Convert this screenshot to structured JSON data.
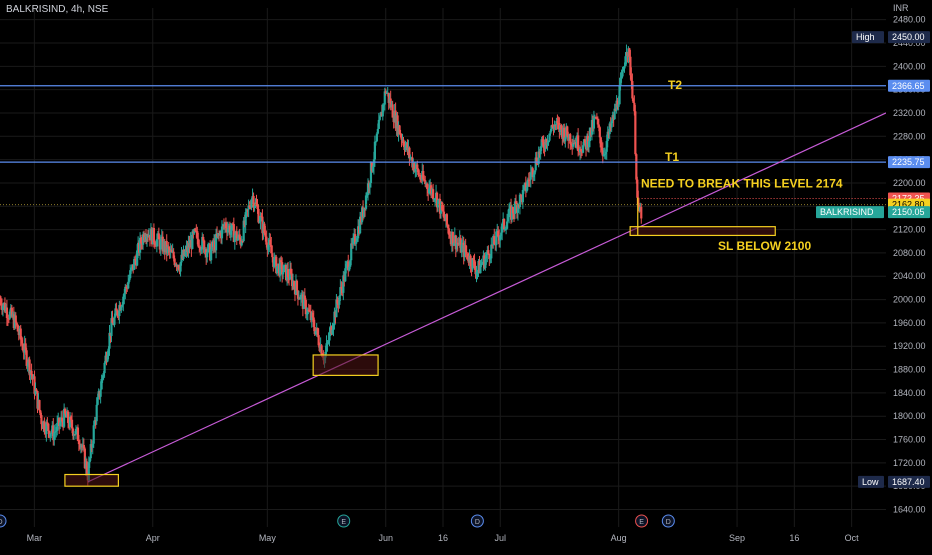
{
  "header": {
    "symbol_line": "BALKRISIND, 4h, NSE",
    "currency": "INR"
  },
  "colors": {
    "background": "#000000",
    "grid": "#1a1a1a",
    "up_candle": "#26a69a",
    "down_candle": "#ef5350",
    "level_line": "#5b8def",
    "trendline": "#c65bd6",
    "annotation": "#f5d020",
    "axis_text": "#b2b5be"
  },
  "chart_data": {
    "type": "candlestick",
    "title": "BALKRISIND, 4h, NSE",
    "ylim": [
      1610,
      2500
    ],
    "y_ticks": [
      2480,
      2440,
      2400,
      2360,
      2320,
      2280,
      2240,
      2200,
      2160,
      2120,
      2080,
      2040,
      2000,
      1960,
      1920,
      1880,
      1840,
      1800,
      1760,
      1720,
      1680,
      1640
    ],
    "x_labels": [
      {
        "label": "Mar",
        "date": "2023-03-01"
      },
      {
        "label": "Apr",
        "date": "2023-04-01"
      },
      {
        "label": "May",
        "date": "2023-05-01"
      },
      {
        "label": "Jun",
        "date": "2023-06-01"
      },
      {
        "label": "16",
        "date": "2023-06-16"
      },
      {
        "label": "Jul",
        "date": "2023-07-01"
      },
      {
        "label": "Aug",
        "date": "2023-08-01"
      },
      {
        "label": "Sep",
        "date": "2023-09-01"
      },
      {
        "label": "16",
        "date": "2023-09-16"
      },
      {
        "label": "Oct",
        "date": "2023-10-01"
      }
    ],
    "x_range": [
      "2023-02-20",
      "2023-10-10"
    ],
    "price_path": [
      [
        "2023-02-20",
        2000
      ],
      [
        "2023-02-24",
        1960
      ],
      [
        "2023-02-28",
        1880
      ],
      [
        "2023-03-03",
        1790
      ],
      [
        "2023-03-06",
        1770
      ],
      [
        "2023-03-09",
        1800
      ],
      [
        "2023-03-13",
        1760
      ],
      [
        "2023-03-15",
        1700
      ],
      [
        "2023-03-17",
        1800
      ],
      [
        "2023-03-21",
        1950
      ],
      [
        "2023-03-25",
        2020
      ],
      [
        "2023-03-30",
        2120
      ],
      [
        "2023-04-04",
        2090
      ],
      [
        "2023-04-08",
        2060
      ],
      [
        "2023-04-12",
        2110
      ],
      [
        "2023-04-16",
        2080
      ],
      [
        "2023-04-20",
        2130
      ],
      [
        "2023-04-24",
        2100
      ],
      [
        "2023-04-27",
        2180
      ],
      [
        "2023-04-29",
        2140
      ],
      [
        "2023-05-03",
        2060
      ],
      [
        "2023-05-07",
        2040
      ],
      [
        "2023-05-10",
        2000
      ],
      [
        "2023-05-13",
        1960
      ],
      [
        "2023-05-16",
        1900
      ],
      [
        "2023-05-18",
        1960
      ],
      [
        "2023-05-22",
        2060
      ],
      [
        "2023-05-26",
        2150
      ],
      [
        "2023-05-29",
        2250
      ],
      [
        "2023-06-01",
        2360
      ],
      [
        "2023-06-04",
        2300
      ],
      [
        "2023-06-07",
        2250
      ],
      [
        "2023-06-10",
        2210
      ],
      [
        "2023-06-14",
        2180
      ],
      [
        "2023-06-18",
        2110
      ],
      [
        "2023-06-22",
        2080
      ],
      [
        "2023-06-25",
        2050
      ],
      [
        "2023-06-28",
        2080
      ],
      [
        "2023-07-03",
        2140
      ],
      [
        "2023-07-07",
        2180
      ],
      [
        "2023-07-11",
        2250
      ],
      [
        "2023-07-15",
        2300
      ],
      [
        "2023-07-19",
        2280
      ],
      [
        "2023-07-23",
        2260
      ],
      [
        "2023-07-26",
        2310
      ],
      [
        "2023-07-28",
        2250
      ],
      [
        "2023-07-31",
        2320
      ],
      [
        "2023-08-02",
        2380
      ],
      [
        "2023-08-03",
        2440
      ],
      [
        "2023-08-04",
        2400
      ],
      [
        "2023-08-05",
        2330
      ],
      [
        "2023-08-06",
        2150
      ],
      [
        "2023-08-07",
        2150
      ]
    ],
    "horizontal_levels": [
      {
        "name": "T2",
        "price": 2366.65,
        "label": "2366.65"
      },
      {
        "name": "T1",
        "price": 2235.75,
        "label": "2235.75"
      }
    ],
    "axis_price_labels": [
      {
        "label": "High",
        "value": "2450.00",
        "price": 2450.0,
        "color": "#1e2a4a"
      },
      {
        "label": "",
        "value": "2366.65",
        "price": 2366.65,
        "color": "#5b8def"
      },
      {
        "label": "",
        "value": "2235.75",
        "price": 2235.75,
        "color": "#5b8def"
      },
      {
        "label": "",
        "value": "2173.35",
        "price": 2173.35,
        "color": "#ef5350"
      },
      {
        "label": "",
        "value": "2162.80",
        "price": 2162.8,
        "color": "#f5d020"
      },
      {
        "label": "BALKRISIND",
        "value": "2150.05",
        "price": 2150.05,
        "color": "#26a69a"
      },
      {
        "label": "Low",
        "value": "1687.40",
        "price": 1687.4,
        "color": "#1e2a4a"
      }
    ],
    "trendline": {
      "from": [
        "2023-03-15",
        1687.4
      ],
      "to": [
        "2023-10-10",
        2320
      ]
    },
    "annotations": {
      "t2": "T2",
      "t1": "T1",
      "break_level": "NEED TO BREAK THIS LEVEL 2174",
      "stop_loss": "SL BELOW 2100"
    },
    "markers": [
      {
        "label": "D",
        "date": "2023-02-20"
      },
      {
        "label": "E",
        "date": "2023-05-21"
      },
      {
        "label": "D",
        "date": "2023-06-25"
      },
      {
        "label": "E",
        "date": "2023-08-07"
      },
      {
        "label": "D",
        "date": "2023-08-14"
      }
    ]
  }
}
